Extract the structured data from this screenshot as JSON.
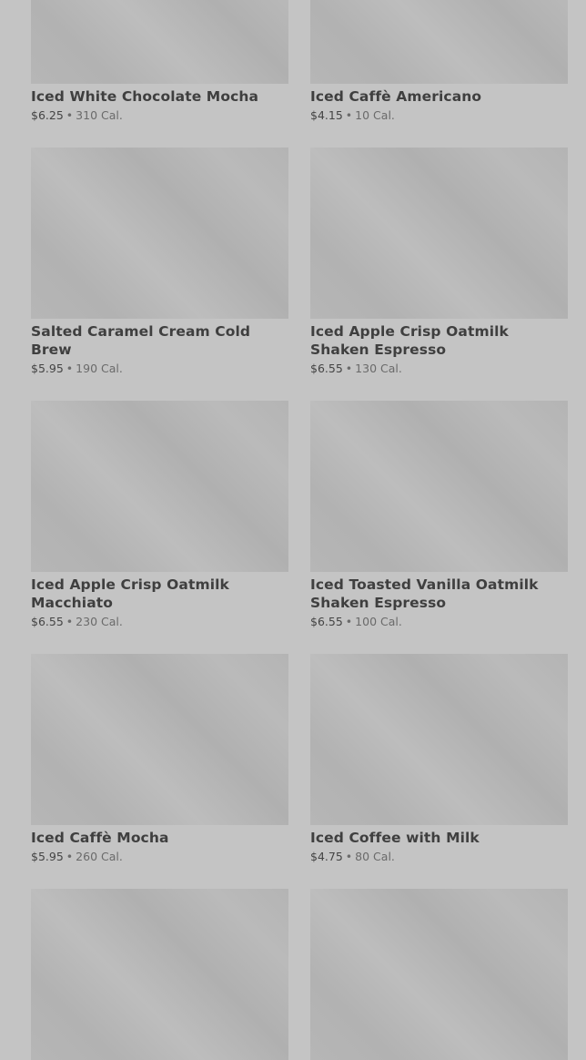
{
  "products": [
    {
      "name": "Iced White Chocolate Mocha",
      "price": "$6.25",
      "calories": "310 Cal."
    },
    {
      "name": "Iced Caffè Americano",
      "price": "$4.15",
      "calories": "10 Cal."
    },
    {
      "name": "Salted Caramel Cream Cold Brew",
      "price": "$5.95",
      "calories": "190 Cal."
    },
    {
      "name": "Iced Apple Crisp Oatmilk Shaken Espresso",
      "price": "$6.55",
      "calories": "130 Cal."
    },
    {
      "name": "Iced Apple Crisp Oatmilk Macchiato",
      "price": "$6.55",
      "calories": "230 Cal."
    },
    {
      "name": "Iced Toasted Vanilla Oatmilk Shaken Espresso",
      "price": "$6.55",
      "calories": "100 Cal."
    },
    {
      "name": "Iced Caffè Mocha",
      "price": "$5.95",
      "calories": "260 Cal."
    },
    {
      "name": "Iced Coffee with Milk",
      "price": "$4.75",
      "calories": "80 Cal."
    },
    {
      "name": "",
      "price": "",
      "calories": ""
    },
    {
      "name": "",
      "price": "",
      "calories": ""
    }
  ],
  "separator": "•"
}
